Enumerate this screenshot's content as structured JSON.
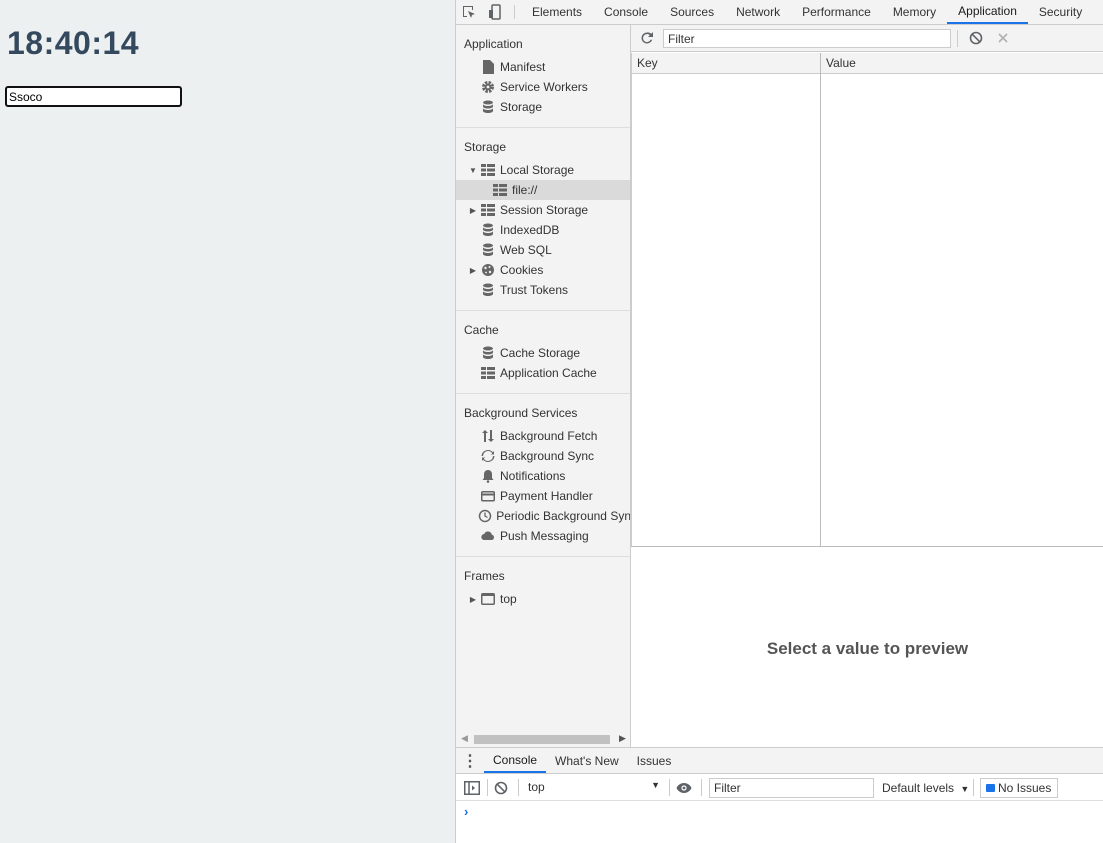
{
  "page": {
    "clock": "18:40:14",
    "input_value": "Ssoco"
  },
  "devtools": {
    "tabs": [
      "Elements",
      "Console",
      "Sources",
      "Network",
      "Performance",
      "Memory",
      "Application",
      "Security"
    ],
    "active_tab": "Application",
    "sidebar": {
      "sections": {
        "application": {
          "title": "Application",
          "items": [
            {
              "label": "Manifest",
              "icon": "file-icon"
            },
            {
              "label": "Service Workers",
              "icon": "gear-icon"
            },
            {
              "label": "Storage",
              "icon": "database-icon"
            }
          ]
        },
        "storage": {
          "title": "Storage",
          "items": [
            {
              "label": "Local Storage",
              "icon": "grid-icon",
              "expanded": true
            },
            {
              "label": "file://",
              "icon": "grid-icon",
              "selected": true
            },
            {
              "label": "Session Storage",
              "icon": "grid-icon"
            },
            {
              "label": "IndexedDB",
              "icon": "database-icon"
            },
            {
              "label": "Web SQL",
              "icon": "database-icon"
            },
            {
              "label": "Cookies",
              "icon": "cookie-icon"
            },
            {
              "label": "Trust Tokens",
              "icon": "database-icon"
            }
          ]
        },
        "cache": {
          "title": "Cache",
          "items": [
            {
              "label": "Cache Storage",
              "icon": "database-icon"
            },
            {
              "label": "Application Cache",
              "icon": "grid-icon"
            }
          ]
        },
        "background": {
          "title": "Background Services",
          "items": [
            {
              "label": "Background Fetch",
              "icon": "arrows-updown-icon"
            },
            {
              "label": "Background Sync",
              "icon": "sync-icon"
            },
            {
              "label": "Notifications",
              "icon": "bell-icon"
            },
            {
              "label": "Payment Handler",
              "icon": "card-icon"
            },
            {
              "label": "Periodic Background Syn",
              "icon": "clock-icon"
            },
            {
              "label": "Push Messaging",
              "icon": "cloud-icon"
            }
          ]
        },
        "frames": {
          "title": "Frames",
          "items": [
            {
              "label": "top",
              "icon": "window-icon"
            }
          ]
        }
      }
    },
    "toolbar": {
      "filter_placeholder": "Filter"
    },
    "grid": {
      "columns": [
        "Key",
        "Value"
      ]
    },
    "preview_text": "Select a value to preview",
    "drawer": {
      "tabs": [
        "Console",
        "What's New",
        "Issues"
      ],
      "active_tab": "Console",
      "context": "top",
      "filter_placeholder": "Filter",
      "levels": "Default levels",
      "issues": "No Issues",
      "prompt": "›"
    }
  },
  "colors": {
    "page_bg": "#ecf0f1",
    "clock": "#34495e",
    "accent": "#1a73e8"
  }
}
